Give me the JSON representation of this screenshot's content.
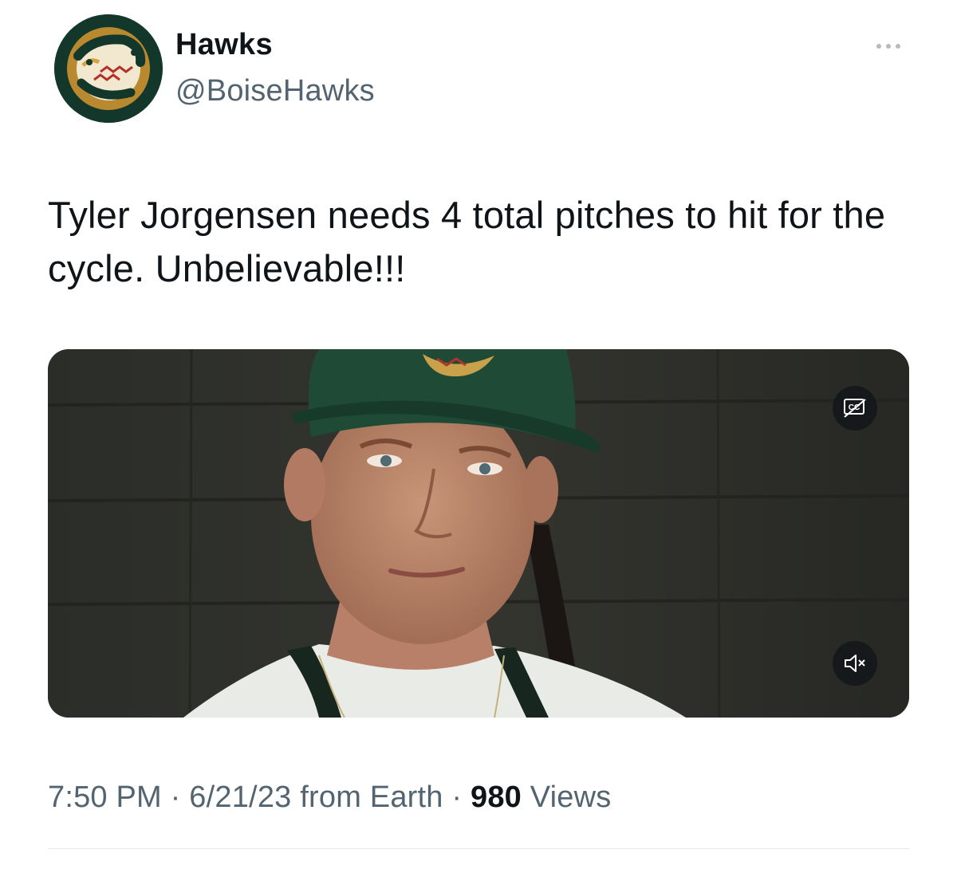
{
  "author": {
    "display_name": "Hawks",
    "handle": "@BoiseHawks",
    "avatar_icon": "boise-hawks-logo"
  },
  "header": {
    "more_icon": "more-horizontal-icon"
  },
  "tweet": {
    "text": "Tyler Jorgensen needs 4 total pitches to hit for the cycle. Unbelievable!!!"
  },
  "media": {
    "type": "video",
    "cc_icon": "closed-captions-icon",
    "mute_icon": "muted-speaker-icon"
  },
  "meta": {
    "time": "7:50 PM",
    "separator": " · ",
    "date": "6/21/23",
    "source": " from Earth",
    "views_count": "980",
    "views_label": " Views"
  },
  "colors": {
    "text_primary": "#0f1419",
    "text_secondary": "#536471",
    "cap_green": "#1f4a36",
    "avatar_bg": "#13382b"
  }
}
